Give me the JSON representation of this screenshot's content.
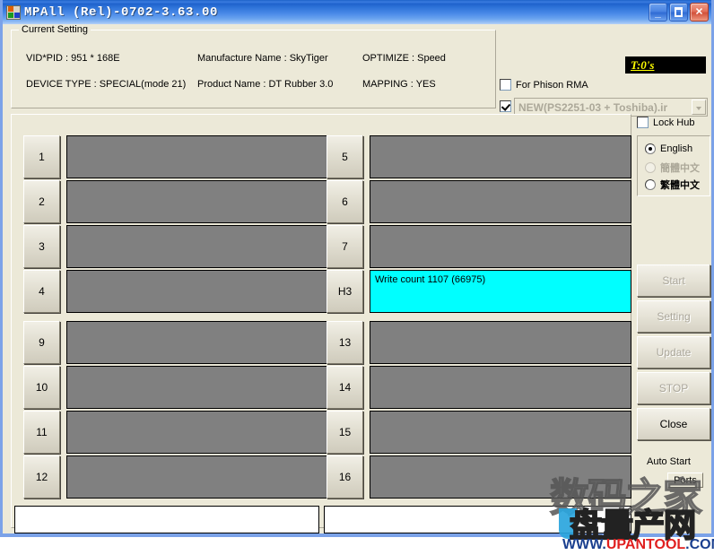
{
  "window": {
    "title": "MPAll (Rel)-0702-3.63.00",
    "icon": "app-icon",
    "buttons": {
      "minimize": "minimize-button",
      "maximize": "maximize-button",
      "close": "close-button"
    }
  },
  "current_setting": {
    "legend": "Current Setting",
    "vid_pid": "VID*PID :  951 * 168E",
    "device_type": "DEVICE TYPE : SPECIAL(mode 21)",
    "manufacture_name": "Manufacture Name : SkyTiger",
    "product_name": "Product Name : DT Rubber 3.0",
    "optimize": "OPTIMIZE : Speed",
    "mapping": "MAPPING : YES"
  },
  "counter": {
    "label": "T:0's",
    "bg_color": "#000000",
    "text_color": "#ffff00"
  },
  "options": {
    "phison_rma": {
      "label": "For Phison RMA",
      "checked": false
    },
    "config_file": {
      "checked": true,
      "value": "NEW(PS2251-03 + Toshiba).ir"
    },
    "lock_hub": {
      "label": "Lock Hub",
      "checked": false
    }
  },
  "language": {
    "options": [
      {
        "label": "English",
        "selected": true,
        "disabled": false
      },
      {
        "label": "簡體中文",
        "selected": false,
        "disabled": true
      },
      {
        "label": "繁體中文",
        "selected": false,
        "disabled": false
      }
    ]
  },
  "actions": {
    "start": {
      "label": "Start",
      "disabled": true
    },
    "setting": {
      "label": "Setting",
      "disabled": true
    },
    "update": {
      "label": "Update",
      "disabled": true
    },
    "stop": {
      "label": "STOP",
      "disabled": true
    },
    "close": {
      "label": "Close",
      "disabled": false
    },
    "auto_start_label": "Auto Start",
    "ports": {
      "label": "Ports"
    }
  },
  "ports": {
    "left": [
      {
        "id": "1",
        "status": "",
        "active": false
      },
      {
        "id": "2",
        "status": "",
        "active": false
      },
      {
        "id": "3",
        "status": "",
        "active": false
      },
      {
        "id": "4",
        "status": "",
        "active": false
      },
      {
        "id": "9",
        "status": "",
        "active": false
      },
      {
        "id": "10",
        "status": "",
        "active": false
      },
      {
        "id": "11",
        "status": "",
        "active": false
      },
      {
        "id": "12",
        "status": "",
        "active": false
      }
    ],
    "right": [
      {
        "id": "5",
        "status": "",
        "active": false
      },
      {
        "id": "6",
        "status": "",
        "active": false
      },
      {
        "id": "7",
        "status": "",
        "active": false
      },
      {
        "id": "H3",
        "status": "Write count 1107 (66975)",
        "active": true
      },
      {
        "id": "13",
        "status": "",
        "active": false
      },
      {
        "id": "14",
        "status": "",
        "active": false
      },
      {
        "id": "15",
        "status": "",
        "active": false
      },
      {
        "id": "16",
        "status": "",
        "active": false
      }
    ],
    "idle_color": "#808080",
    "active_color": "#00ffff"
  },
  "bottom_fields": {
    "left_value": "",
    "right_value": ""
  },
  "watermark": {
    "line1": "数码之家",
    "line2": "盘量产网",
    "url_prefix": "WWW.",
    "url_mid": "UPANTOOL",
    "url_suffix": ".COM"
  }
}
